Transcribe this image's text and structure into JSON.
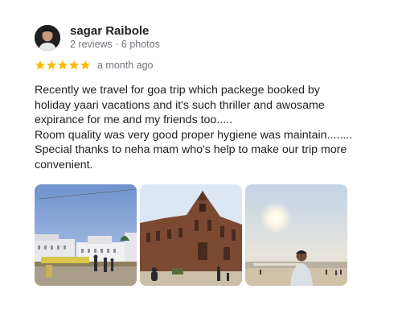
{
  "review": {
    "author_name": "sagar Raibole",
    "author_meta": "2 reviews · 6 photos",
    "rating": 5,
    "rating_max": 5,
    "star_color": "#fbbc04",
    "date": "a month ago",
    "text_lines": [
      "Recently we travel for goa trip which packege booked by",
      "holiday yaari vacations and it's such thriller and awosame",
      "expirance for me and my friends too.....",
      "Room quality was very good proper hygiene was maintain........",
      "Special thanks to neha mam who's help to make our trip more",
      "convenient."
    ],
    "photos": [
      {
        "name": "review-photo-white-buildings"
      },
      {
        "name": "review-photo-basilica"
      },
      {
        "name": "review-photo-beach-sunset"
      }
    ]
  }
}
